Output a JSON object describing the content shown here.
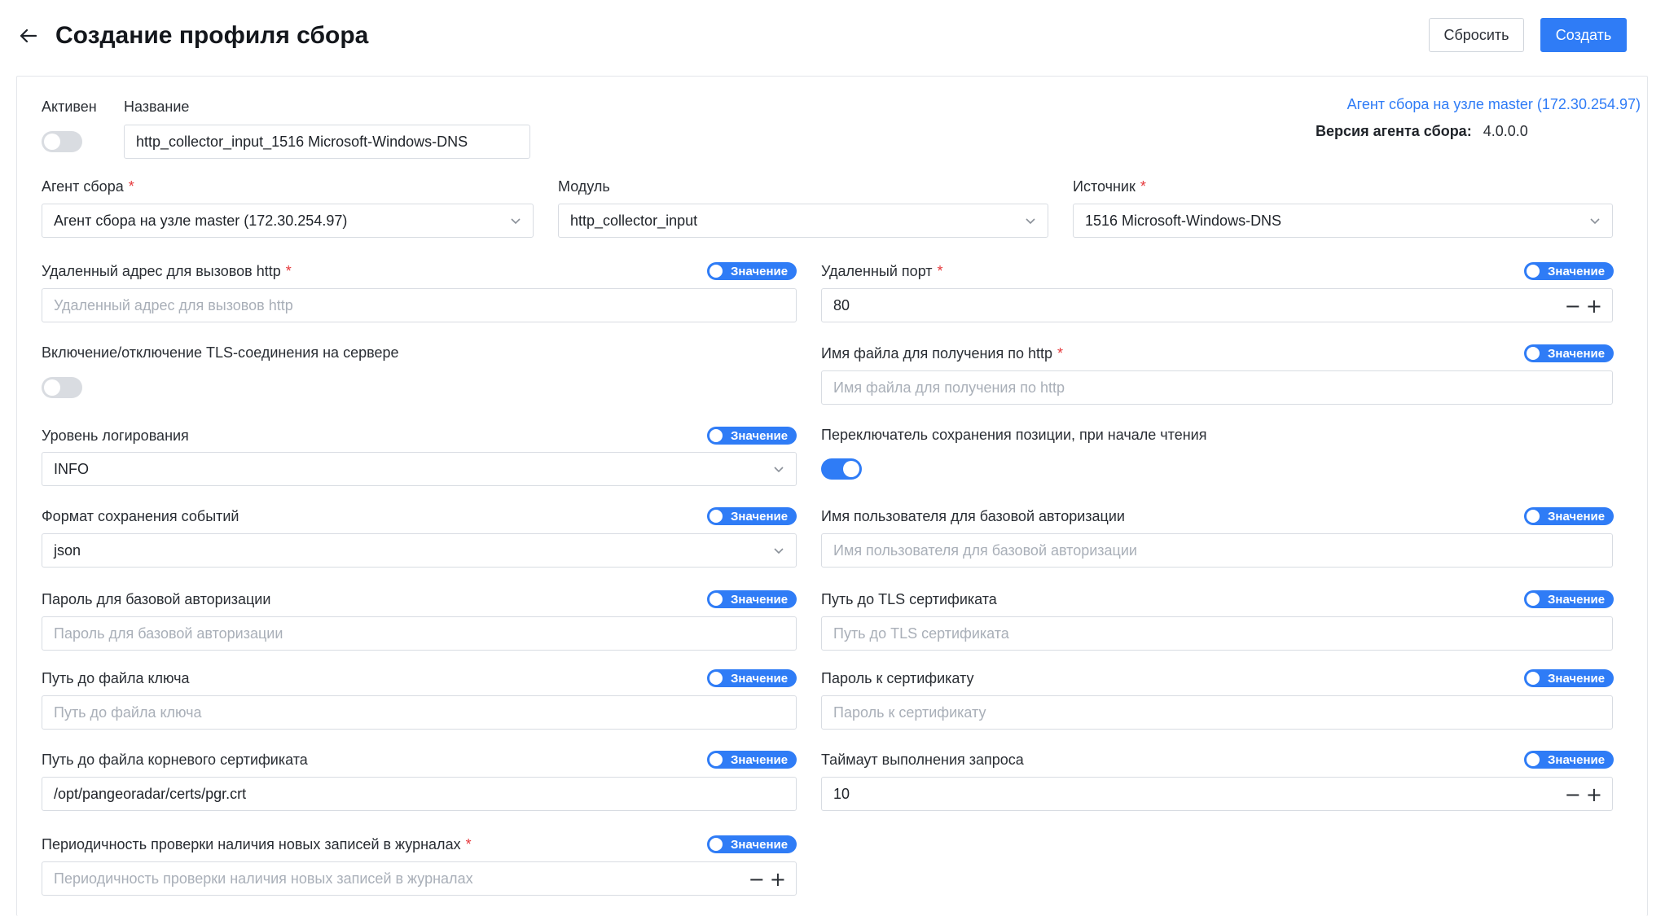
{
  "header": {
    "title": "Создание профиля сбора",
    "reset_label": "Сбросить",
    "create_label": "Создать"
  },
  "colors": {
    "accent": "#2f7cf6",
    "required": "#e5383b",
    "border": "#d8dce2"
  },
  "top": {
    "active_label": "Активен",
    "active_on": false,
    "name_label": "Название",
    "name_value": "http_collector_input_1516 Microsoft-Windows-DNS",
    "agent_link": "Агент сбора на узле master (172.30.254.97)",
    "agent_version_label": "Версия агента сбора:",
    "agent_version_value": "4.0.0.0"
  },
  "selects": {
    "agent_label": "Агент сбора",
    "agent_value": "Агент сбора на узле master (172.30.254.97)",
    "module_label": "Модуль",
    "module_value": "http_collector_input",
    "source_label": "Источник",
    "source_value": "1516 Microsoft-Windows-DNS"
  },
  "value_toggle_label": "Значение",
  "fields": {
    "remote_address": {
      "label": "Удаленный адрес для вызовов http",
      "placeholder": "Удаленный адрес для вызовов http"
    },
    "remote_port": {
      "label": "Удаленный порт",
      "value": "80"
    },
    "tls_toggle": {
      "label": "Включение/отключение TLS-соединения на сервере",
      "on": false
    },
    "file_name": {
      "label": "Имя файла для получения по http",
      "placeholder": "Имя файла для получения по http"
    },
    "log_level": {
      "label": "Уровень логирования",
      "value": "INFO"
    },
    "save_position": {
      "label": "Переключатель сохранения позиции, при начале чтения",
      "on": true
    },
    "event_format": {
      "label": "Формат сохранения событий",
      "value": "json"
    },
    "auth_user": {
      "label": "Имя пользователя для базовой авторизации",
      "placeholder": "Имя пользователя для базовой авторизации"
    },
    "auth_password": {
      "label": "Пароль для базовой авторизации",
      "placeholder": "Пароль для базовой авторизации"
    },
    "tls_cert_path": {
      "label": "Путь до TLS сертификата",
      "placeholder": "Путь до TLS сертификата"
    },
    "key_path": {
      "label": "Путь до файла ключа",
      "placeholder": "Путь до файла ключа"
    },
    "cert_password": {
      "label": "Пароль к сертификату",
      "placeholder": "Пароль к сертификату"
    },
    "root_cert_path": {
      "label": "Путь до файла корневого сертификата",
      "value": "/opt/pangeoradar/certs/pgr.crt"
    },
    "request_timeout": {
      "label": "Таймаут выполнения запроса",
      "value": "10"
    },
    "check_period": {
      "label": "Периодичность проверки наличия новых записей в журналах",
      "placeholder": "Периодичность проверки наличия новых записей в журналах"
    }
  }
}
